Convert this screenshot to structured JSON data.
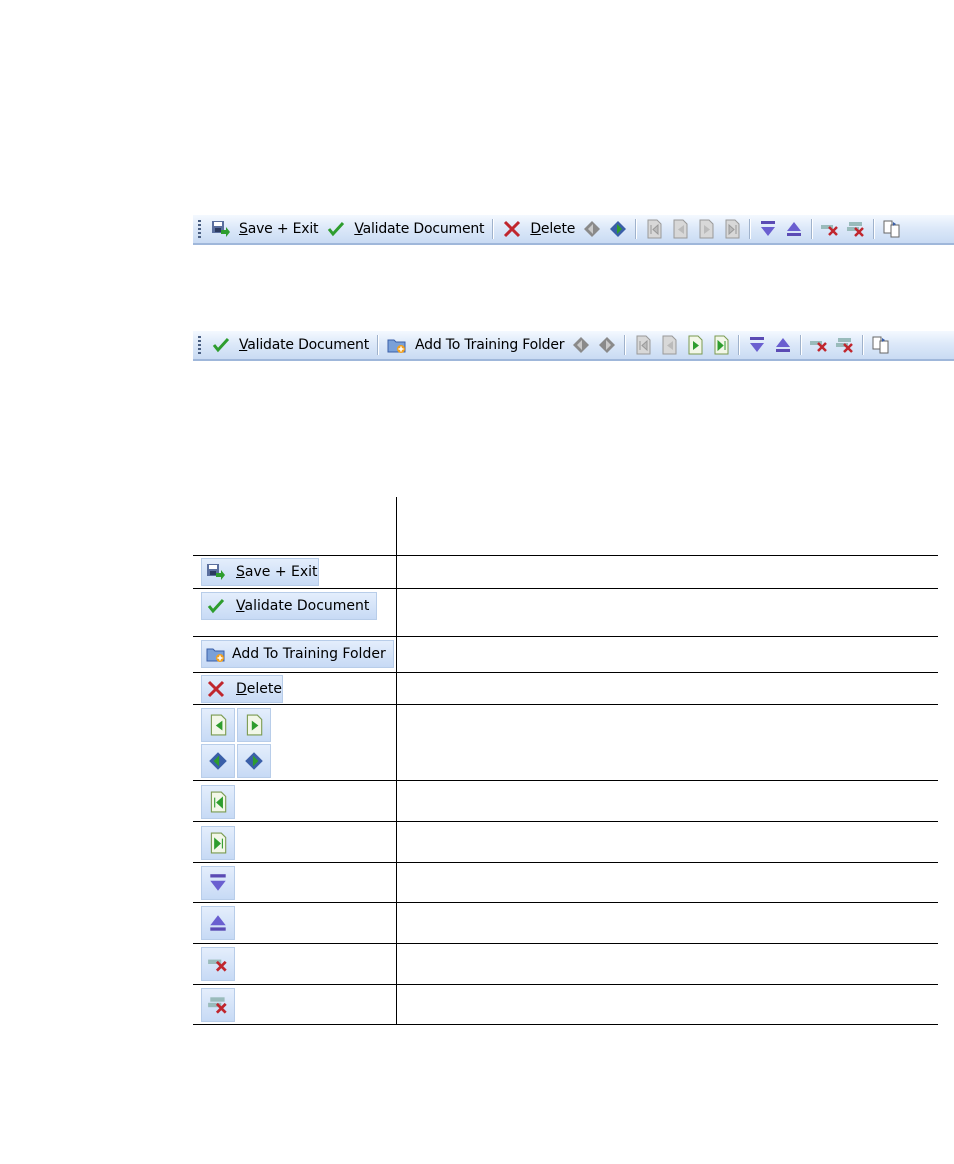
{
  "toolbar1": {
    "save_label_u": "S",
    "save_label_rest": "ave + Exit",
    "validate_u": "V",
    "validate_rest": "alidate Document",
    "delete_u": "D",
    "delete_rest": "elete"
  },
  "toolbar2": {
    "validate_u": "V",
    "validate_rest": "alidate Document",
    "add_training": "Add To Training Folder"
  },
  "table": {
    "rows": [
      {
        "u": "S",
        "rest": "ave + Exit"
      },
      {
        "u": "V",
        "rest": "alidate Document"
      },
      {
        "label": "Add To Training Folder"
      },
      {
        "u": "D",
        "rest": "elete"
      }
    ]
  },
  "colors": {
    "toolbar_top": "#f4f9ff",
    "toolbar_bottom": "#c9dbf3",
    "accent_green": "#2e9d2e",
    "delete_red": "#c0262d",
    "arrow_purple": "#5b4bb4"
  },
  "icons": [
    "save-exit-icon",
    "checkmark-icon",
    "delete-x-icon",
    "prev-batch-icon",
    "next-batch-icon",
    "first-page-icon",
    "prev-page-icon",
    "next-page-icon",
    "last-page-icon",
    "move-down-icon",
    "move-up-icon",
    "remove-field-icon",
    "remove-all-icon",
    "copy-icon",
    "add-training-folder-icon"
  ]
}
